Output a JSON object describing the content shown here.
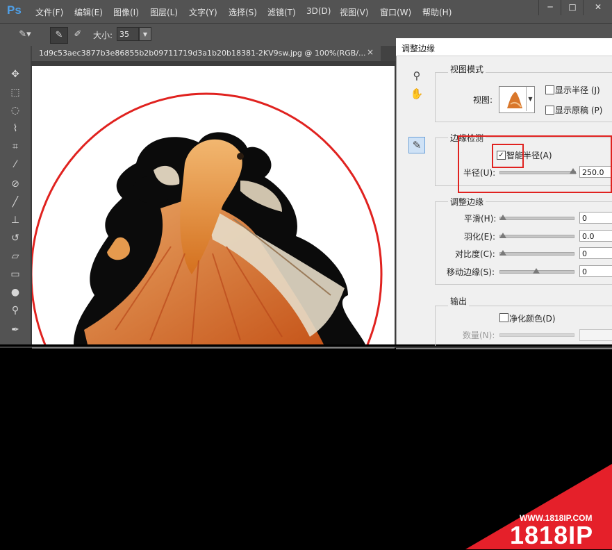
{
  "app": {
    "logo": "Ps"
  },
  "menu": [
    "文件(F)",
    "编辑(E)",
    "图像(I)",
    "图层(L)",
    "文字(Y)",
    "选择(S)",
    "滤镜(T)",
    "3D(D)",
    "视图(V)",
    "窗口(W)",
    "帮助(H)"
  ],
  "window_controls": {
    "minimize": "─",
    "maximize": "□",
    "close": "✕"
  },
  "options": {
    "size_label": "大小:",
    "size_value": "35"
  },
  "document": {
    "tab_title": "1d9c53aec3877b3e86855b2b09711719d3a1b20b18381-2KV9sw.jpg @ 100%(RGB/...",
    "close": "×"
  },
  "tools": [
    "move-icon",
    "marquee-icon",
    "lasso-icon",
    "quick-select-icon",
    "crop-icon",
    "eyedropper-icon",
    "healing-icon",
    "brush-icon",
    "stamp-icon",
    "history-brush-icon",
    "eraser-icon",
    "gradient-icon",
    "blur-icon",
    "dodge-icon",
    "pen-icon"
  ],
  "dialog": {
    "title": "调整边缘",
    "view_mode": {
      "group_title": "视图模式",
      "view_label": "视图:",
      "show_radius": "显示半径 (J)",
      "show_original": "显示原稿 (P)"
    },
    "edge_detection": {
      "group_title": "边缘检测",
      "smart_radius": "智能半径(A)",
      "smart_radius_checked": true,
      "radius_label": "半径(U):",
      "radius_value": "250.0",
      "radius_level": 1.0
    },
    "adjust_edge": {
      "group_title": "调整边缘",
      "rows": [
        {
          "label": "平滑(H):",
          "value": "0",
          "level": 0
        },
        {
          "label": "羽化(E):",
          "value": "0.0",
          "level": 0
        },
        {
          "label": "对比度(C):",
          "value": "0",
          "level": 0
        },
        {
          "label": "移动边缘(S):",
          "value": "0",
          "level": 0.5
        }
      ]
    },
    "output": {
      "group_title": "输出",
      "decontaminate": "净化颜色(D)",
      "amount_label": "数量(N):"
    }
  },
  "watermark": {
    "url": "WWW.1818IP.COM",
    "brand": "1818IP"
  },
  "colors": {
    "ps_blue": "#4fa0e8",
    "highlight_red": "#e0221f",
    "panel": "#535353"
  }
}
